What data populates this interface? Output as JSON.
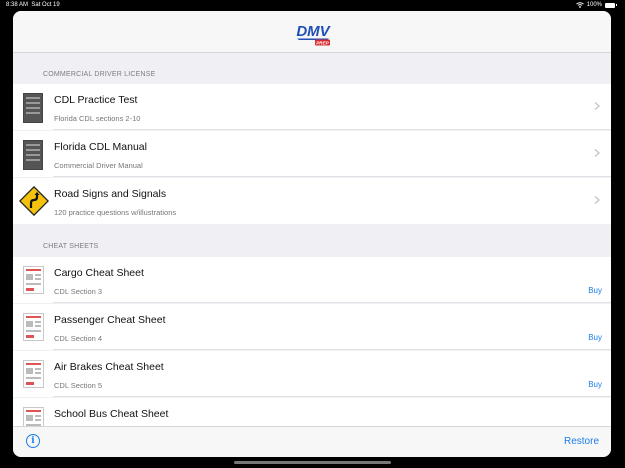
{
  "status": {
    "time": "8:38 AM",
    "date": "Sat Oct 19",
    "battery": "100%"
  },
  "logo": {
    "text": "DMV",
    "badge": "PREP"
  },
  "sections": [
    {
      "header": "COMMERCIAL DRIVER LICENSE"
    },
    {
      "header": "CHEAT SHEETS"
    }
  ],
  "license_items": [
    {
      "title": "CDL Practice Test",
      "subtitle": "Florida CDL sections 2-10"
    },
    {
      "title": "Florida CDL Manual",
      "subtitle": "Commercial Driver Manual"
    },
    {
      "title": "Road Signs and Signals",
      "subtitle": "120 practice questions w/illustrations"
    }
  ],
  "cheat_items": [
    {
      "title": "Cargo Cheat Sheet",
      "subtitle": "CDL Section 3",
      "action": "Buy"
    },
    {
      "title": "Passenger Cheat Sheet",
      "subtitle": "CDL Section 4",
      "action": "Buy"
    },
    {
      "title": "Air Brakes Cheat Sheet",
      "subtitle": "CDL Section 5",
      "action": "Buy"
    },
    {
      "title": "School Bus Cheat Sheet",
      "subtitle": "",
      "action": ""
    }
  ],
  "toolbar": {
    "info_label": "i",
    "restore_label": "Restore"
  },
  "colors": {
    "accent": "#1a7ee8",
    "logo_blue": "#1f4fb6",
    "badge_red": "#d92b2b",
    "sign_yellow": "#f4c20d"
  }
}
